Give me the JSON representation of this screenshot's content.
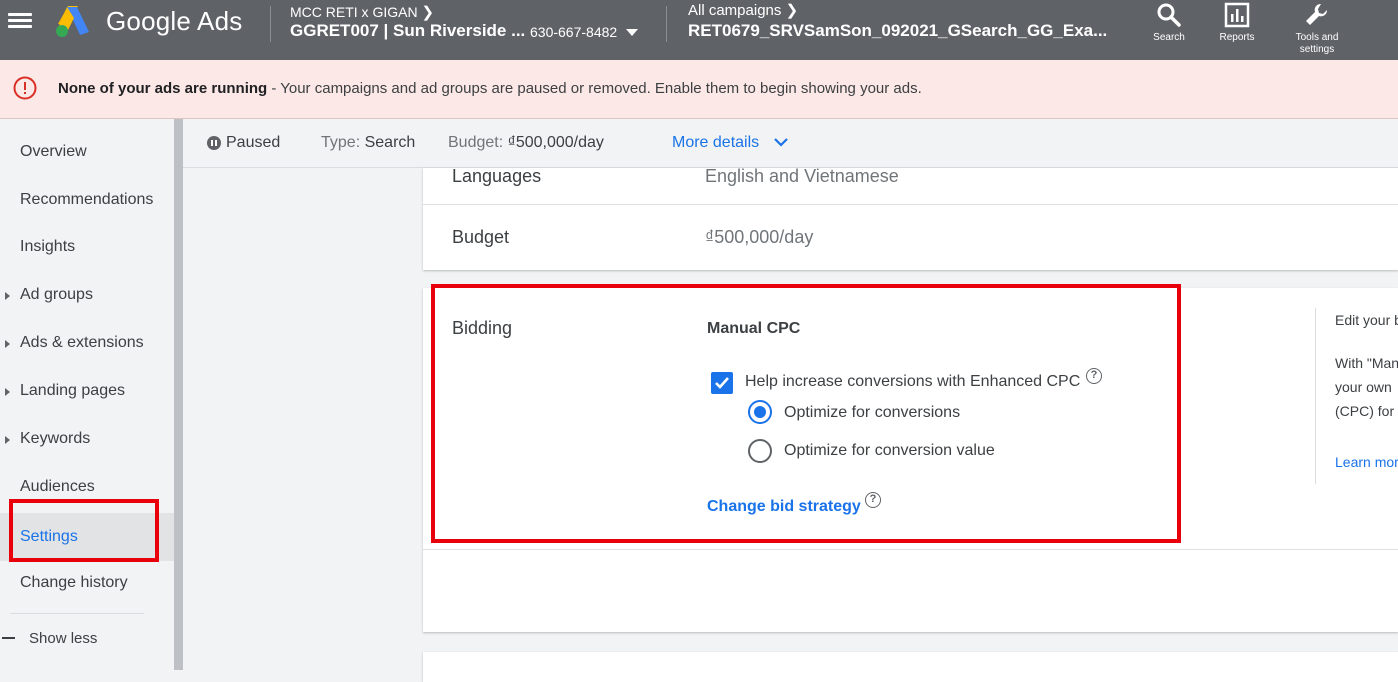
{
  "topbar": {
    "brand": "Google Ads",
    "account_manager": "MCC RETI x GIGAN",
    "account_name": "GGRET007 | Sun Riverside ...",
    "account_id": "630-667-8482",
    "campaign_scope": "All campaigns",
    "campaign_name": "RET0679_SRVSamSon_092021_GSearch_GG_Exa...",
    "search_label": "Search",
    "reports_label": "Reports",
    "tools_label_1": "Tools and",
    "tools_label_2": "settings"
  },
  "alert": {
    "bold": "None of your ads are running",
    "message": " - Your campaigns and ad groups are paused or removed. Enable them to begin showing your ads."
  },
  "sidebar": {
    "items": [
      {
        "label": "Overview"
      },
      {
        "label": "Recommendations"
      },
      {
        "label": "Insights"
      },
      {
        "label": "Ad groups"
      },
      {
        "label": "Ads & extensions"
      },
      {
        "label": "Landing pages"
      },
      {
        "label": "Keywords"
      },
      {
        "label": "Audiences"
      },
      {
        "label": "Settings"
      },
      {
        "label": "Change history"
      }
    ],
    "show_less": "Show less"
  },
  "status": {
    "state": "Paused",
    "type_label": "Type:",
    "type_value": "Search",
    "budget_label": "Budget:",
    "budget_value": "₫500,000/day",
    "more_details": "More details"
  },
  "settings": {
    "languages_label": "Languages",
    "languages_value": "English and Vietnamese",
    "budget_label": "Budget",
    "budget_value": "₫500,000/day"
  },
  "bidding": {
    "title": "Bidding",
    "strategy": "Manual CPC",
    "enhanced_cpc_label": "Help increase conversions with Enhanced CPC",
    "opt_conversions": "Optimize for conversions",
    "opt_value": "Optimize for conversion value",
    "change_link": "Change bid strategy",
    "side_line1": "Edit your b",
    "side_line2": "With \"Man",
    "side_line3": "your own",
    "side_line4": "(CPC) for",
    "side_link": "Learn mor"
  },
  "colors": {
    "accent": "#1a73e8",
    "highlight": "#e8000a",
    "topbar": "#5f6368",
    "alert_bg": "#fce8e6"
  }
}
